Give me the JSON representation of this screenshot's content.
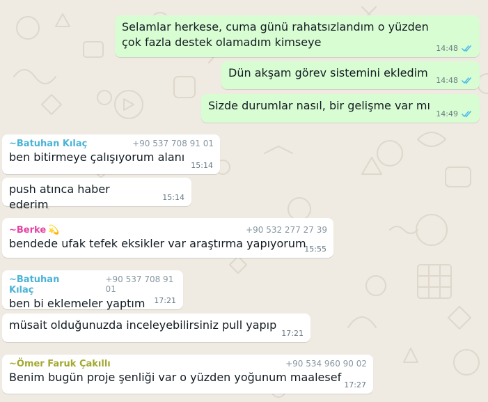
{
  "colors": {
    "background": "#efeae2",
    "outgoing_bubble": "#d9fdd3",
    "incoming_bubble": "#ffffff",
    "read_check": "#53bdeb",
    "sender_batuhan": "#4ab3d6",
    "sender_berke": "#e542a3",
    "sender_omer": "#a3a831"
  },
  "outgoing": [
    {
      "text": "Selamlar herkese, cuma günü rahatsızlandım o yüzden çok fazla destek olamadım kimseye",
      "time": "14:48",
      "status_icon": "double-check-read"
    },
    {
      "text": "Dün akşam görev sistemini ekledim",
      "time": "14:48",
      "status_icon": "double-check-read"
    },
    {
      "text": "Sizde durumlar nasıl, bir gelişme var mı",
      "time": "14:49",
      "status_icon": "double-check-read"
    }
  ],
  "incoming": [
    {
      "sender": "~Batuhan Kılaç",
      "phone": "+90 537 708 91 01",
      "text": "ben bitirmeye çalışıyorum alanı",
      "time": "15:14"
    },
    {
      "text": "push atınca haber ederim",
      "time": "15:14"
    },
    {
      "sender": "~Berke",
      "sender_emoji": "💫",
      "phone": "+90 532 277 27 39",
      "text": "bendede ufak tefek eksikler var araştırma yapıyorum",
      "time": "15:55"
    },
    {
      "sender": "~Batuhan Kılaç",
      "phone": "+90 537 708 91 01",
      "text": "ben bi eklemeler yaptım",
      "time": "17:21"
    },
    {
      "text": "müsait olduğunuzda inceleyebilirsiniz pull yapıp",
      "time": "17:21"
    },
    {
      "sender": "~Ömer Faruk Çakıllı",
      "phone": "+90 534 960 90 02",
      "text": "Benim bugün proje şenliği var o yüzden yoğunum maalesef",
      "time": "17:27"
    }
  ]
}
